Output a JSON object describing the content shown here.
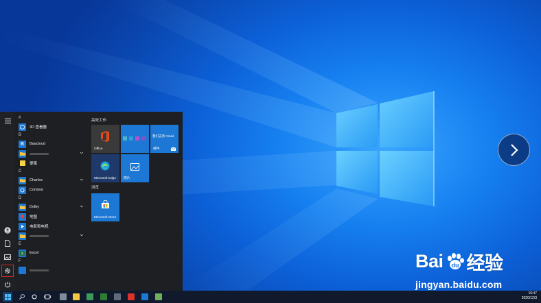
{
  "start_menu": {
    "groups": [
      {
        "letter": "#",
        "apps": [
          {
            "label": "3D 查看器",
            "icon": "cube-icon",
            "color": "#1c78d4"
          }
        ]
      },
      {
        "letter": "B",
        "apps": [
          {
            "label": "Baacloud",
            "icon": "letter-b-icon",
            "color": "#1c78d4"
          },
          {
            "label": "",
            "icon": "folder-icon",
            "color": "#1c78d4",
            "expandable": true
          },
          {
            "label": "便笺",
            "icon": "sticky-note-icon",
            "color": "#1a1a1a"
          }
        ]
      },
      {
        "letter": "C",
        "apps": [
          {
            "label": "Charles",
            "icon": "folder-icon",
            "color": "#1c78d4",
            "expandable": true
          },
          {
            "label": "Cortana",
            "icon": "cortana-icon",
            "color": "#1c78d4"
          }
        ]
      },
      {
        "letter": "D",
        "apps": [
          {
            "label": "Dolby",
            "icon": "folder-icon",
            "color": "#1c78d4",
            "expandable": true
          },
          {
            "label": "地图",
            "icon": "map-pin-icon",
            "color": "#1c78d4"
          },
          {
            "label": "电影和电视",
            "icon": "movies-icon",
            "color": "#1c78d4"
          },
          {
            "label": "",
            "icon": "folder-icon",
            "color": "#1c78d4",
            "expandable": true
          }
        ]
      },
      {
        "letter": "E",
        "apps": [
          {
            "label": "Excel",
            "icon": "excel-icon",
            "color": "#1c78d4"
          }
        ]
      },
      {
        "letter": "F",
        "apps": [
          {
            "label": "",
            "icon": "app-icon",
            "color": "#1c78d4"
          }
        ]
      }
    ],
    "sections": {
      "work": "高效工作",
      "browse": "浏览"
    },
    "tiles": {
      "office": "Office",
      "mail_top": "我们支持 Gmail",
      "mail": "邮件",
      "edge": "Microsoft Edge",
      "photos": "照片",
      "store": "Microsoft Store"
    }
  },
  "taskbar": {
    "time": "16:47",
    "date": "2020/12/3"
  },
  "watermark": {
    "brand": "Bai",
    "brand2": "经验",
    "url": "jingyan.baidu.com"
  },
  "colors": {
    "accent": "#1c78d4",
    "menu_bg": "#1e1f22",
    "taskbar_bg": "#101a2c"
  }
}
